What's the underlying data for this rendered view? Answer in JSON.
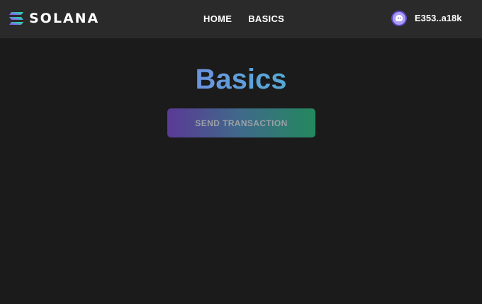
{
  "navbar": {
    "logo_text": "SOLANA",
    "logo_icon": "solana-logo-icon",
    "links": [
      {
        "label": "HOME"
      },
      {
        "label": "BASICS"
      }
    ],
    "wallet": {
      "address": "E353..a18k",
      "avatar_icon": "phantom-ghost-icon"
    }
  },
  "main": {
    "title": "Basics",
    "send_button_label": "SEND TRANSACTION"
  },
  "colors": {
    "background": "#1b1b1b",
    "navbar": "#2a2a2a",
    "gradient_purple": "#9a5cf0",
    "gradient_green": "#2fc7a0",
    "wallet_avatar": "#ab9ff2"
  }
}
